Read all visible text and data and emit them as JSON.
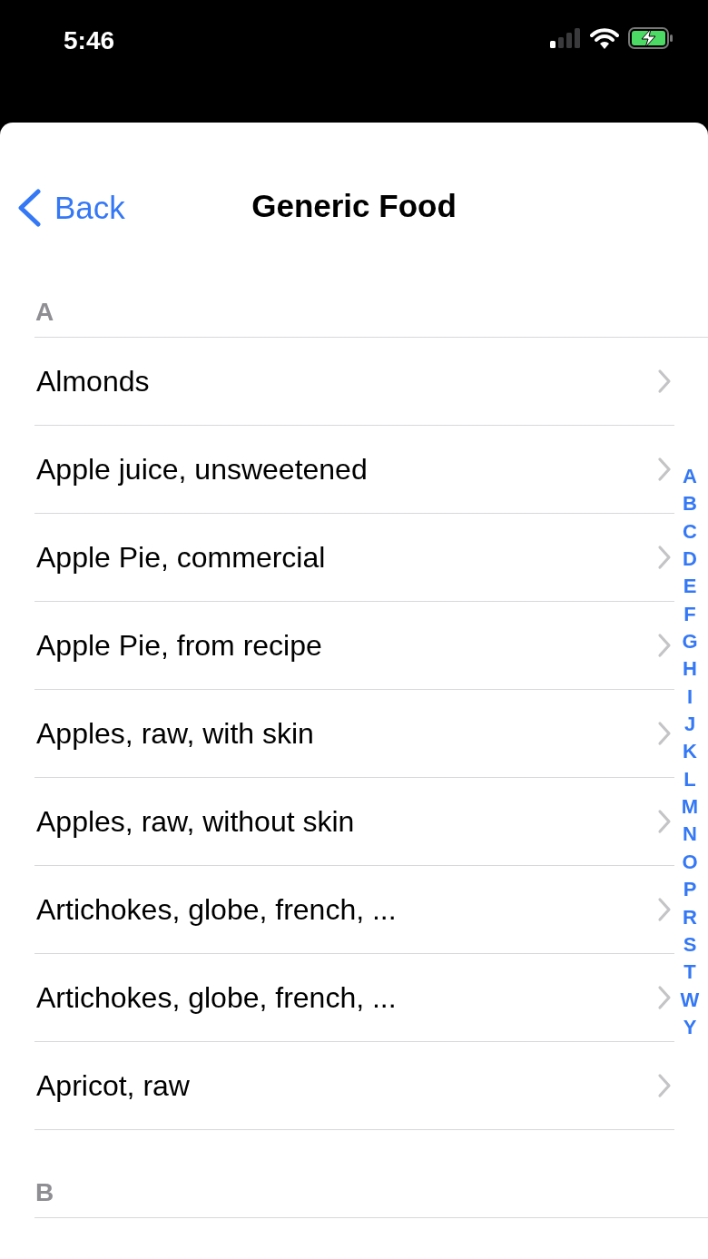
{
  "status_bar": {
    "time": "5:46",
    "battery_charging": true
  },
  "nav": {
    "back": "Back",
    "title": "Generic Food"
  },
  "sections": [
    {
      "letter": "A",
      "items": [
        "Almonds",
        "Apple juice, unsweetened",
        "Apple Pie, commercial",
        "Apple Pie, from recipe",
        "Apples, raw, with skin",
        "Apples, raw, without skin",
        "Artichokes, globe, french, ...",
        "Artichokes, globe, french, ...",
        "Apricot, raw"
      ]
    },
    {
      "letter": "B"
    }
  ],
  "index": [
    "A",
    "B",
    "C",
    "D",
    "E",
    "F",
    "G",
    "H",
    "I",
    "J",
    "K",
    "L",
    "M",
    "N",
    "O",
    "P",
    "R",
    "S",
    "T",
    "W",
    "Y"
  ]
}
